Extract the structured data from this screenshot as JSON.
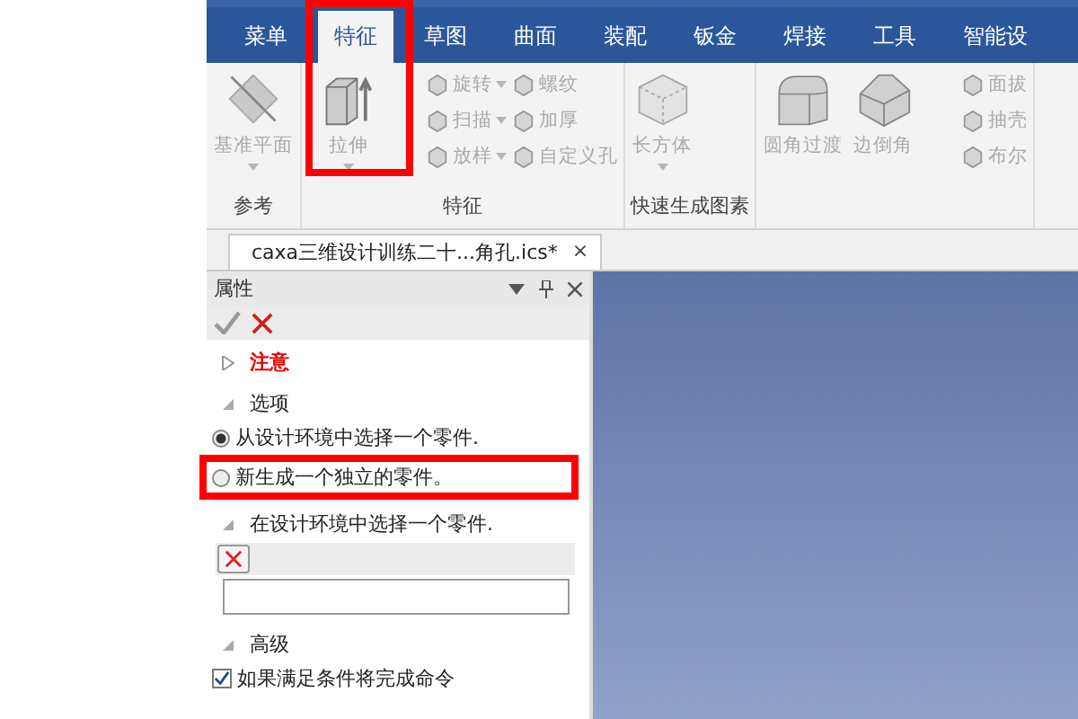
{
  "menu_tabs": [
    {
      "label": "菜单",
      "selected": false
    },
    {
      "label": "特征",
      "selected": true
    },
    {
      "label": "草图",
      "selected": false
    },
    {
      "label": "曲面",
      "selected": false
    },
    {
      "label": "装配",
      "selected": false
    },
    {
      "label": "钣金",
      "selected": false
    },
    {
      "label": "焊接",
      "selected": false
    },
    {
      "label": "工具",
      "selected": false
    },
    {
      "label": "智能设",
      "selected": false
    }
  ],
  "ribbon_groups": [
    {
      "label": "参考",
      "large": [
        {
          "label": "基准平面",
          "dropdown": true
        }
      ]
    },
    {
      "label": "特征",
      "large": [
        {
          "label": "拉伸",
          "dropdown": true
        }
      ],
      "small": [
        {
          "label": "旋转",
          "dropdown": true
        },
        {
          "label": "扫描",
          "dropdown": true
        },
        {
          "label": "放样",
          "dropdown": true
        },
        {
          "label": "螺纹",
          "dropdown": false
        },
        {
          "label": "加厚",
          "dropdown": false
        },
        {
          "label": "自定义孔",
          "dropdown": false
        }
      ]
    },
    {
      "label": "快速生成图素",
      "large": [
        {
          "label": "长方体",
          "dropdown": true
        }
      ]
    },
    {
      "large": [
        {
          "label": "圆角过渡",
          "dropdown": false
        },
        {
          "label": "边倒角",
          "dropdown": false
        }
      ],
      "small": [
        {
          "label": "面拔",
          "dropdown": false
        },
        {
          "label": "抽壳",
          "dropdown": false
        },
        {
          "label": "布尔",
          "dropdown": false
        }
      ]
    }
  ],
  "document_tab": {
    "title": "caxa三维设计训练二十...角孔.ics*",
    "close": "×"
  },
  "panel": {
    "title": "属性",
    "sections": [
      {
        "kind": "note",
        "label": "注意",
        "expanded": false
      },
      {
        "kind": "radios",
        "label": "选项",
        "expanded": true,
        "options": [
          {
            "label": "从设计环境中选择一个零件.",
            "selected": true
          },
          {
            "label": "新生成一个独立的零件。",
            "selected": false
          }
        ]
      },
      {
        "kind": "picker",
        "label": "在设计环境中选择一个零件.",
        "expanded": true
      },
      {
        "kind": "checks",
        "label": "高级",
        "expanded": true,
        "options": [
          {
            "label": "如果满足条件将完成命令",
            "checked": true
          }
        ]
      }
    ]
  }
}
